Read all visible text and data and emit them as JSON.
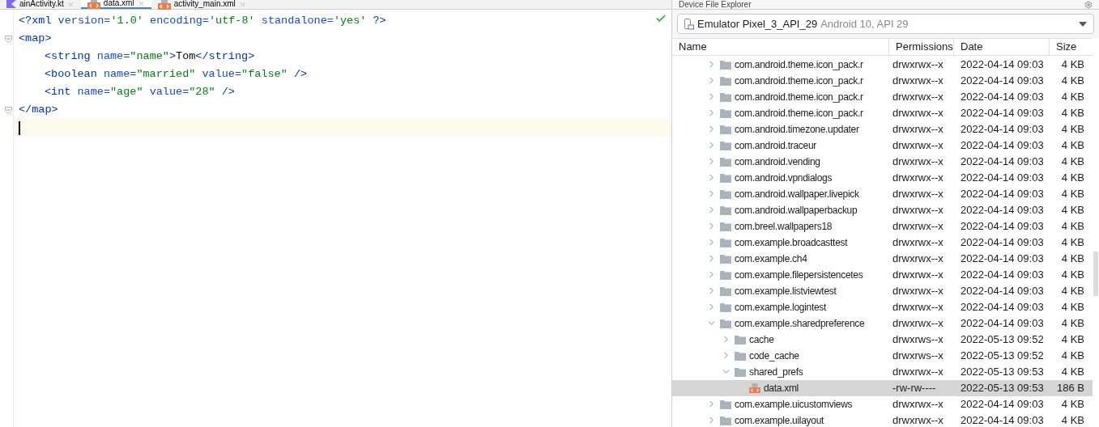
{
  "editor_tabs": [
    {
      "label": "ainActivity.kt",
      "kind": "kotlin",
      "selected": false
    },
    {
      "label": "data.xml",
      "kind": "xml",
      "selected": true
    },
    {
      "label": "activity_main.xml",
      "kind": "xml",
      "selected": false
    }
  ],
  "editor": {
    "lines": [
      {
        "foldable": false,
        "current": false,
        "tokens": [
          {
            "kind": "tag",
            "text": "<?xml"
          },
          {
            "kind": "attr",
            "text": " version="
          },
          {
            "kind": "value",
            "text": "'1.0'"
          },
          {
            "kind": "attr",
            "text": " encoding="
          },
          {
            "kind": "value",
            "text": "'utf-8'"
          },
          {
            "kind": "attr",
            "text": " standalone="
          },
          {
            "kind": "value",
            "text": "'yes'"
          },
          {
            "kind": "tag",
            "text": " ?>"
          }
        ]
      },
      {
        "foldable": true,
        "current": false,
        "tokens": [
          {
            "kind": "tag",
            "text": "<map>"
          }
        ],
        "children": [
          {
            "foldable": false,
            "current": false,
            "tokens": [
              {
                "kind": "tag",
                "text": "<string"
              },
              {
                "kind": "attr",
                "text": " name="
              },
              {
                "kind": "value",
                "text": "\"name\""
              },
              {
                "kind": "tag",
                "text": ">"
              },
              {
                "kind": "text",
                "text": "Tom"
              },
              {
                "kind": "tag",
                "text": "</string>"
              }
            ]
          },
          {
            "foldable": false,
            "current": false,
            "tokens": [
              {
                "kind": "tag",
                "text": "<boolean"
              },
              {
                "kind": "attr",
                "text": " name="
              },
              {
                "kind": "value",
                "text": "\"married\""
              },
              {
                "kind": "attr",
                "text": " value="
              },
              {
                "kind": "value",
                "text": "\"false\""
              },
              {
                "kind": "tag",
                "text": " />"
              }
            ]
          },
          {
            "foldable": false,
            "current": false,
            "tokens": [
              {
                "kind": "tag",
                "text": "<int"
              },
              {
                "kind": "attr",
                "text": " name="
              },
              {
                "kind": "value",
                "text": "\"age\""
              },
              {
                "kind": "attr",
                "text": " value="
              },
              {
                "kind": "value",
                "text": "\"28\""
              },
              {
                "kind": "tag",
                "text": " />"
              }
            ]
          }
        ]
      },
      {
        "foldable": true,
        "current": false,
        "tokens": [
          {
            "kind": "tag",
            "text": "</map>"
          }
        ]
      },
      {
        "current": true
      }
    ]
  },
  "explorer": {
    "title": "Device File Explorer",
    "device": {
      "name": "Emulator Pixel_3_API_29",
      "detail": "Android 10, API 29"
    },
    "columns": [
      "Name",
      "Permissions",
      "Date",
      "Size"
    ],
    "rows": [
      {
        "name": "com.android.theme.icon_pack.r",
        "kind": "folder",
        "expanded": false,
        "selected": false,
        "permissions": "drwxrwx--x",
        "date": "2022-04-14 09:03",
        "size": "4 KB"
      },
      {
        "name": "com.android.theme.icon_pack.r",
        "kind": "folder",
        "expanded": false,
        "selected": false,
        "permissions": "drwxrwx--x",
        "date": "2022-04-14 09:03",
        "size": "4 KB"
      },
      {
        "name": "com.android.theme.icon_pack.r",
        "kind": "folder",
        "expanded": false,
        "selected": false,
        "permissions": "drwxrwx--x",
        "date": "2022-04-14 09:03",
        "size": "4 KB"
      },
      {
        "name": "com.android.theme.icon_pack.r",
        "kind": "folder",
        "expanded": false,
        "selected": false,
        "permissions": "drwxrwx--x",
        "date": "2022-04-14 09:03",
        "size": "4 KB"
      },
      {
        "name": "com.android.timezone.updater",
        "kind": "folder",
        "expanded": false,
        "selected": false,
        "permissions": "drwxrwx--x",
        "date": "2022-04-14 09:03",
        "size": "4 KB"
      },
      {
        "name": "com.android.traceur",
        "kind": "folder",
        "expanded": false,
        "selected": false,
        "permissions": "drwxrwx--x",
        "date": "2022-04-14 09:03",
        "size": "4 KB"
      },
      {
        "name": "com.android.vending",
        "kind": "folder",
        "expanded": false,
        "selected": false,
        "permissions": "drwxrwx--x",
        "date": "2022-04-14 09:03",
        "size": "4 KB"
      },
      {
        "name": "com.android.vpndialogs",
        "kind": "folder",
        "expanded": false,
        "selected": false,
        "permissions": "drwxrwx--x",
        "date": "2022-04-14 09:03",
        "size": "4 KB"
      },
      {
        "name": "com.android.wallpaper.livepick",
        "kind": "folder",
        "expanded": false,
        "selected": false,
        "permissions": "drwxrwx--x",
        "date": "2022-04-14 09:03",
        "size": "4 KB"
      },
      {
        "name": "com.android.wallpaperbackup",
        "kind": "folder",
        "expanded": false,
        "selected": false,
        "permissions": "drwxrwx--x",
        "date": "2022-04-14 09:03",
        "size": "4 KB"
      },
      {
        "name": "com.breel.wallpapers18",
        "kind": "folder",
        "expanded": false,
        "selected": false,
        "permissions": "drwxrwx--x",
        "date": "2022-04-14 09:03",
        "size": "4 KB"
      },
      {
        "name": "com.example.broadcasttest",
        "kind": "folder",
        "expanded": false,
        "selected": false,
        "permissions": "drwxrwx--x",
        "date": "2022-04-14 09:03",
        "size": "4 KB"
      },
      {
        "name": "com.example.ch4",
        "kind": "folder",
        "expanded": false,
        "selected": false,
        "permissions": "drwxrwx--x",
        "date": "2022-04-14 09:03",
        "size": "4 KB"
      },
      {
        "name": "com.example.filepersistencetes",
        "kind": "folder",
        "expanded": false,
        "selected": false,
        "permissions": "drwxrwx--x",
        "date": "2022-04-14 09:03",
        "size": "4 KB"
      },
      {
        "name": "com.example.listviewtest",
        "kind": "folder",
        "expanded": false,
        "selected": false,
        "permissions": "drwxrwx--x",
        "date": "2022-04-14 09:03",
        "size": "4 KB"
      },
      {
        "name": "com.example.logintest",
        "kind": "folder",
        "expanded": false,
        "selected": false,
        "permissions": "drwxrwx--x",
        "date": "2022-04-14 09:03",
        "size": "4 KB"
      },
      {
        "name": "com.example.sharedpreference",
        "kind": "folder",
        "expanded": true,
        "selected": false,
        "permissions": "drwxrwx--x",
        "date": "2022-04-14 09:03",
        "size": "4 KB",
        "children": [
          {
            "name": "cache",
            "kind": "folder",
            "expanded": false,
            "selected": false,
            "permissions": "drwxrws--x",
            "date": "2022-05-13 09:52",
            "size": "4 KB"
          },
          {
            "name": "code_cache",
            "kind": "folder",
            "expanded": false,
            "selected": false,
            "permissions": "drwxrws--x",
            "date": "2022-05-13 09:52",
            "size": "4 KB"
          },
          {
            "name": "shared_prefs",
            "kind": "folder",
            "expanded": true,
            "selected": false,
            "permissions": "drwxrwx--x",
            "date": "2022-05-13 09:53",
            "size": "4 KB",
            "children": [
              {
                "name": "data.xml",
                "kind": "file",
                "selected": true,
                "permissions": "-rw-rw----",
                "date": "2022-05-13 09:53",
                "size": "186 B"
              }
            ]
          }
        ]
      },
      {
        "name": "com.example.uicustomviews",
        "kind": "folder",
        "expanded": false,
        "selected": false,
        "permissions": "drwxrwx--x",
        "date": "2022-04-14 09:03",
        "size": "4 KB"
      },
      {
        "name": "com.example.uilayout",
        "kind": "folder",
        "expanded": false,
        "selected": false,
        "permissions": "drwxrwx--x",
        "date": "2022-04-14 09:03",
        "size": "4 KB"
      }
    ]
  }
}
